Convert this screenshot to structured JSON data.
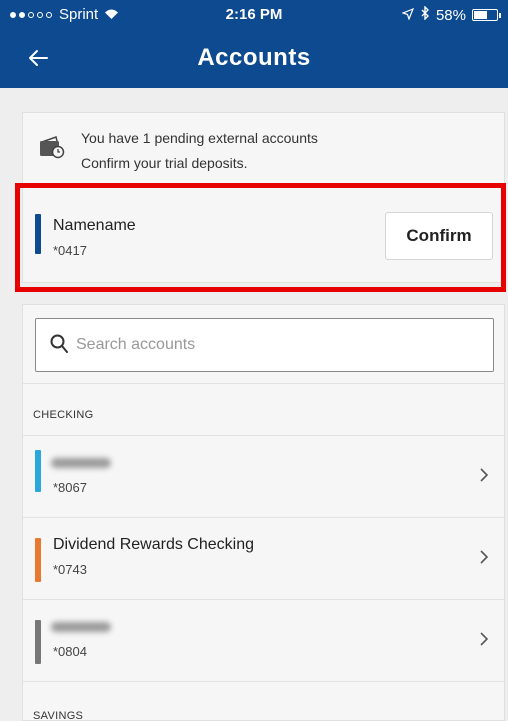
{
  "status_bar": {
    "carrier": "Sprint",
    "time": "2:16 PM",
    "battery": "58%",
    "battery_level": 0.58
  },
  "nav": {
    "back_icon": "arrow-left-icon",
    "title": "Accounts"
  },
  "pending": {
    "notice_line1": "You have 1 pending external accounts",
    "notice_line2": "Confirm your trial deposits.",
    "account": {
      "name": "Namename",
      "number": "*0417",
      "color": "#0d4a8f"
    },
    "confirm_label": "Confirm"
  },
  "search": {
    "placeholder": "Search accounts"
  },
  "sections": [
    {
      "label": "CHECKING",
      "accounts": [
        {
          "name": "",
          "number": "*8067",
          "color": "#2aa8de",
          "blurred": true
        },
        {
          "name": "Dividend Rewards Checking",
          "number": "*0743",
          "color": "#e8792e",
          "blurred": false
        },
        {
          "name": "",
          "number": "*0804",
          "color": "#777777",
          "blurred": true
        }
      ]
    },
    {
      "label": "SAVINGS",
      "accounts": []
    }
  ],
  "colors": {
    "header": "#0d4a8f",
    "highlight": "#e60000"
  }
}
